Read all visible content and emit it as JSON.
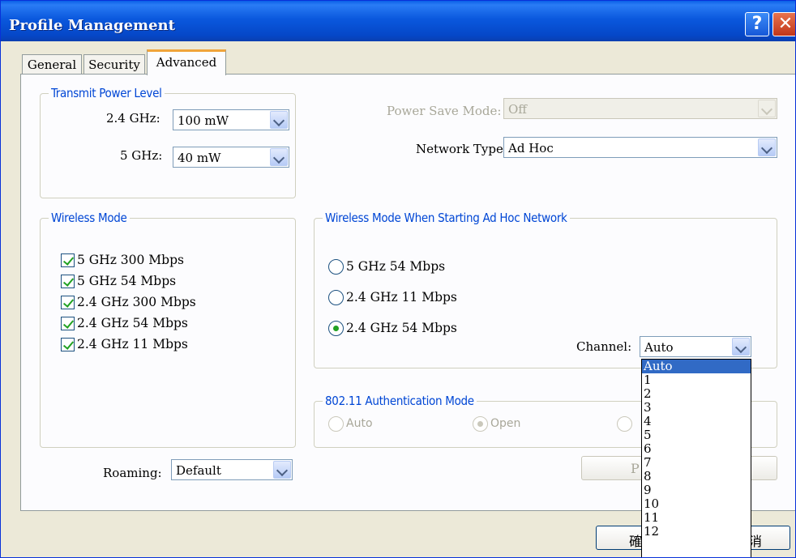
{
  "window": {
    "title": "Profile Management",
    "help_label": "?",
    "close_label": "✕"
  },
  "tabs": [
    {
      "label": "General"
    },
    {
      "label": "Security"
    },
    {
      "label": "Advanced"
    }
  ],
  "transmit_power": {
    "legend": "Transmit Power Level",
    "ghz24_label": "2.4 GHz:",
    "ghz24_value": "100 mW",
    "ghz5_label": "5 GHz:",
    "ghz5_value": "40 mW"
  },
  "power_save": {
    "label": "Power Save Mode:",
    "value": "Off"
  },
  "network_type": {
    "label": "Network Type:",
    "value": "Ad Hoc"
  },
  "wireless_mode": {
    "legend": "Wireless Mode",
    "options": [
      {
        "label": "5 GHz 300 Mbps",
        "checked": true
      },
      {
        "label": "5 GHz 54 Mbps",
        "checked": true
      },
      {
        "label": "2.4 GHz 300 Mbps",
        "checked": true
      },
      {
        "label": "2.4 GHz 54 Mbps",
        "checked": true
      },
      {
        "label": "2.4 GHz 11 Mbps",
        "checked": true
      }
    ]
  },
  "adhoc_mode": {
    "legend": "Wireless Mode When Starting Ad Hoc Network",
    "options": [
      {
        "label": "5 GHz 54 Mbps",
        "selected": false
      },
      {
        "label": "2.4 GHz 11 Mbps",
        "selected": false
      },
      {
        "label": "2.4 GHz 54 Mbps",
        "selected": true
      }
    ],
    "channel_label": "Channel:",
    "channel_value": "Auto"
  },
  "auth_mode": {
    "legend": "802.11 Authentication Mode",
    "options": [
      {
        "label": "Auto",
        "selected": false
      },
      {
        "label": "Open",
        "selected": true
      }
    ]
  },
  "roaming": {
    "label": "Roaming:",
    "value": "Default"
  },
  "preferred_button_partial": "P",
  "ok_button_partial": "確",
  "cancel_button_partial": "消",
  "channel_dropdown": {
    "items": [
      "Auto",
      "1",
      "2",
      "3",
      "4",
      "5",
      "6",
      "7",
      "8",
      "9",
      "10",
      "11",
      "12"
    ],
    "selected": "Auto"
  }
}
